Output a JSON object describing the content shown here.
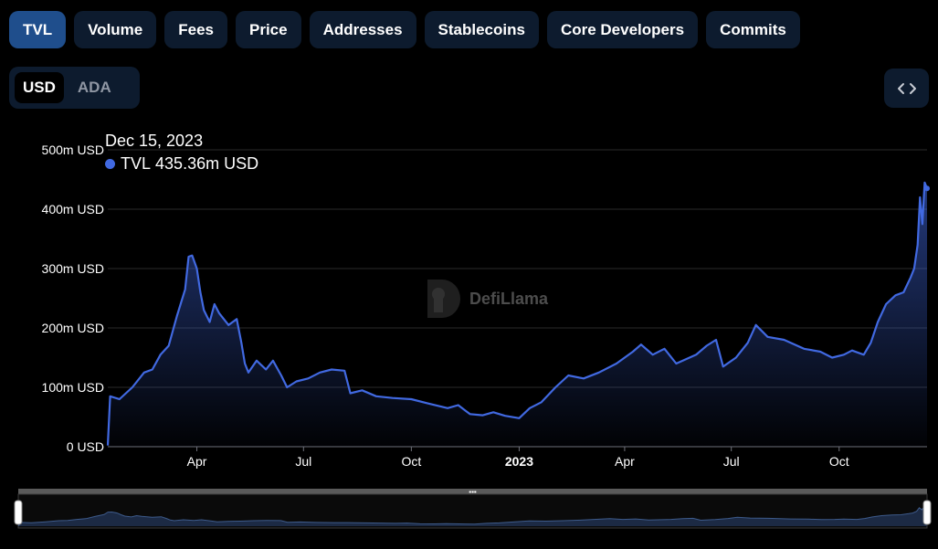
{
  "tabs": [
    {
      "label": "TVL",
      "active": true
    },
    {
      "label": "Volume",
      "active": false
    },
    {
      "label": "Fees",
      "active": false
    },
    {
      "label": "Price",
      "active": false
    },
    {
      "label": "Addresses",
      "active": false
    },
    {
      "label": "Stablecoins",
      "active": false
    },
    {
      "label": "Core Developers",
      "active": false
    },
    {
      "label": "Commits",
      "active": false
    }
  ],
  "currency": {
    "options": [
      {
        "label": "USD",
        "active": true
      },
      {
        "label": "ADA",
        "active": false
      }
    ]
  },
  "embed": {
    "icon": "code-brackets-icon",
    "glyph": "‹ ›"
  },
  "tooltip": {
    "date": "Dec 15, 2023",
    "series": "TVL",
    "value": "435.36m USD",
    "dot_color": "#4169e1"
  },
  "watermark": {
    "text": "DefiLlama",
    "icon": "llama-logo-icon"
  },
  "colors": {
    "line": "#4169e1",
    "grid": "#2a2a2a",
    "background": "#000000"
  },
  "chart_data": {
    "type": "area",
    "series": [
      {
        "name": "TVL",
        "unit": "m USD"
      }
    ],
    "ylim": [
      0,
      500
    ],
    "yticks": [
      {
        "value": 0,
        "label": "0 USD"
      },
      {
        "value": 100,
        "label": "100m USD"
      },
      {
        "value": 200,
        "label": "200m USD"
      },
      {
        "value": 300,
        "label": "300m USD"
      },
      {
        "value": 400,
        "label": "400m USD"
      },
      {
        "value": 500,
        "label": "500m USD"
      }
    ],
    "xlim": [
      "2022-01-15",
      "2023-12-15"
    ],
    "xticks": [
      {
        "date": "2022-04-01",
        "label": "Apr",
        "major": false
      },
      {
        "date": "2022-07-01",
        "label": "Jul",
        "major": false
      },
      {
        "date": "2022-10-01",
        "label": "Oct",
        "major": false
      },
      {
        "date": "2023-01-01",
        "label": "2023",
        "major": true
      },
      {
        "date": "2023-04-01",
        "label": "Apr",
        "major": false
      },
      {
        "date": "2023-07-01",
        "label": "Jul",
        "major": false
      },
      {
        "date": "2023-10-01",
        "label": "Oct",
        "major": false
      }
    ],
    "grid": true,
    "points": [
      [
        "2022-01-15",
        2
      ],
      [
        "2022-01-17",
        85
      ],
      [
        "2022-01-25",
        80
      ],
      [
        "2022-02-05",
        100
      ],
      [
        "2022-02-15",
        125
      ],
      [
        "2022-02-22",
        130
      ],
      [
        "2022-03-01",
        155
      ],
      [
        "2022-03-08",
        170
      ],
      [
        "2022-03-15",
        220
      ],
      [
        "2022-03-22",
        265
      ],
      [
        "2022-03-25",
        320
      ],
      [
        "2022-03-28",
        322
      ],
      [
        "2022-04-01",
        300
      ],
      [
        "2022-04-04",
        260
      ],
      [
        "2022-04-07",
        230
      ],
      [
        "2022-04-12",
        210
      ],
      [
        "2022-04-16",
        240
      ],
      [
        "2022-04-20",
        225
      ],
      [
        "2022-04-28",
        205
      ],
      [
        "2022-05-05",
        215
      ],
      [
        "2022-05-09",
        175
      ],
      [
        "2022-05-12",
        140
      ],
      [
        "2022-05-15",
        125
      ],
      [
        "2022-05-22",
        145
      ],
      [
        "2022-05-30",
        130
      ],
      [
        "2022-06-05",
        145
      ],
      [
        "2022-06-12",
        120
      ],
      [
        "2022-06-17",
        100
      ],
      [
        "2022-06-25",
        110
      ],
      [
        "2022-07-05",
        115
      ],
      [
        "2022-07-15",
        125
      ],
      [
        "2022-07-25",
        130
      ],
      [
        "2022-08-05",
        128
      ],
      [
        "2022-08-10",
        90
      ],
      [
        "2022-08-20",
        95
      ],
      [
        "2022-09-01",
        85
      ],
      [
        "2022-09-15",
        82
      ],
      [
        "2022-10-01",
        80
      ],
      [
        "2022-10-15",
        73
      ],
      [
        "2022-11-01",
        65
      ],
      [
        "2022-11-10",
        70
      ],
      [
        "2022-11-20",
        55
      ],
      [
        "2022-12-01",
        53
      ],
      [
        "2022-12-10",
        58
      ],
      [
        "2022-12-20",
        52
      ],
      [
        "2023-01-01",
        48
      ],
      [
        "2023-01-10",
        65
      ],
      [
        "2023-01-20",
        75
      ],
      [
        "2023-02-01",
        100
      ],
      [
        "2023-02-12",
        120
      ],
      [
        "2023-02-25",
        115
      ],
      [
        "2023-03-10",
        125
      ],
      [
        "2023-03-25",
        140
      ],
      [
        "2023-04-08",
        160
      ],
      [
        "2023-04-15",
        172
      ],
      [
        "2023-04-25",
        155
      ],
      [
        "2023-05-05",
        165
      ],
      [
        "2023-05-15",
        140
      ],
      [
        "2023-06-01",
        155
      ],
      [
        "2023-06-10",
        170
      ],
      [
        "2023-06-18",
        180
      ],
      [
        "2023-06-24",
        135
      ],
      [
        "2023-07-05",
        150
      ],
      [
        "2023-07-15",
        175
      ],
      [
        "2023-07-22",
        205
      ],
      [
        "2023-08-01",
        185
      ],
      [
        "2023-08-15",
        180
      ],
      [
        "2023-09-01",
        165
      ],
      [
        "2023-09-15",
        160
      ],
      [
        "2023-09-25",
        150
      ],
      [
        "2023-10-05",
        155
      ],
      [
        "2023-10-12",
        162
      ],
      [
        "2023-10-22",
        155
      ],
      [
        "2023-10-28",
        175
      ],
      [
        "2023-11-03",
        210
      ],
      [
        "2023-11-10",
        240
      ],
      [
        "2023-11-18",
        255
      ],
      [
        "2023-11-25",
        260
      ],
      [
        "2023-12-01",
        285
      ],
      [
        "2023-12-04",
        300
      ],
      [
        "2023-12-07",
        340
      ],
      [
        "2023-12-09",
        420
      ],
      [
        "2023-12-11",
        375
      ],
      [
        "2023-12-13",
        445
      ],
      [
        "2023-12-15",
        435
      ]
    ]
  }
}
